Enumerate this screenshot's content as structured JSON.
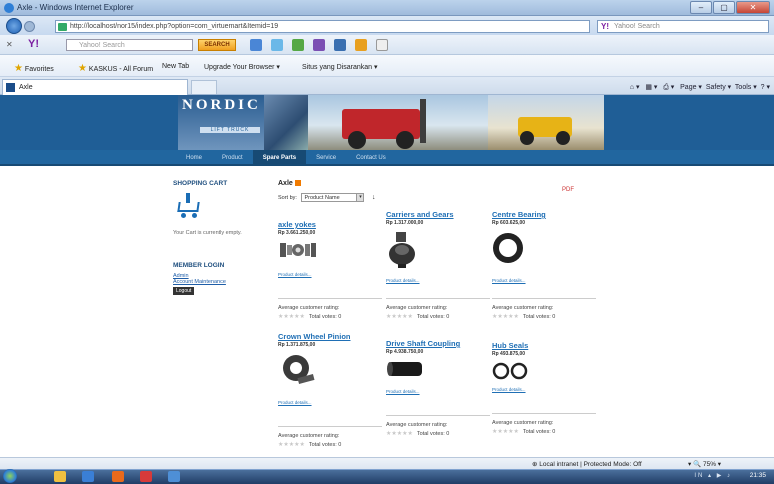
{
  "window": {
    "title": "Axle - Windows Internet Explorer",
    "min": "–",
    "max": "▢",
    "close": "✕"
  },
  "addressbar": {
    "url": "http://localhost/nor15/index.php?option=com_virtuemart&Itemid=19",
    "search_placeholder": "Yahoo! Search"
  },
  "toolbar": {
    "yahoo": "Y!",
    "search_placeholder": "Yahoo! Search",
    "search_button": "SEARCH"
  },
  "favorites": {
    "label": "Favorites",
    "items": [
      "KASKUS - All Forum",
      "New Tab",
      "Upgrade Your Browser ▾",
      "Situs yang Disarankan ▾"
    ]
  },
  "tab": {
    "title": "Axle"
  },
  "commandbar": {
    "page": "Page ▾",
    "safety": "Safety ▾",
    "tools": "Tools ▾"
  },
  "site": {
    "logo": "NORDIC",
    "logo_sub": "LIFT TRUCK",
    "menu": [
      "Home",
      "Product",
      "Spare Parts",
      "Service",
      "Contact Us"
    ],
    "active_menu": "Spare Parts"
  },
  "sidebar": {
    "cart_title": "SHOPPING CART",
    "cart_text": "Your Cart is currently empty.",
    "login_title": "MEMBER LOGIN",
    "links": [
      "Admin",
      "Account Maintenance"
    ],
    "logout": "Logout"
  },
  "category": {
    "title": "Axle",
    "sort_label": "Sort by:",
    "sort_value": "Product Name"
  },
  "products": [
    {
      "name": "axle yokes",
      "price": "Rp 3.661.250,00",
      "more": "Product details...",
      "rating": "Average customer rating:",
      "votes": "Total votes: 0"
    },
    {
      "name": "Carriers and Gears",
      "price": "Rp 1.317.000,00",
      "more": "Product details...",
      "rating": "Average customer rating:",
      "votes": "Total votes: 0"
    },
    {
      "name": "Centre Bearing",
      "price": "Rp 603.625,00",
      "more": "Product details...",
      "rating": "Average customer rating:",
      "votes": "Total votes: 0"
    },
    {
      "name": "Crown Wheel Pinion",
      "price": "Rp 1.371.875,00",
      "more": "Product details...",
      "rating": "Average customer rating:",
      "votes": "Total votes: 0"
    },
    {
      "name": "Drive Shaft Coupling",
      "price": "Rp 4.938.750,00",
      "more": "Product details...",
      "rating": "Average customer rating:",
      "votes": "Total votes: 0"
    },
    {
      "name": "Hub Seals",
      "price": "Rp 493.875,00",
      "more": "Product details...",
      "rating": "Average customer rating:",
      "votes": "Total votes: 0"
    }
  ],
  "status": {
    "zone": "Local intranet | Protected Mode: Off",
    "zoom": "75%"
  },
  "taskbar": {
    "time": "21:35",
    "lang": "IN"
  }
}
